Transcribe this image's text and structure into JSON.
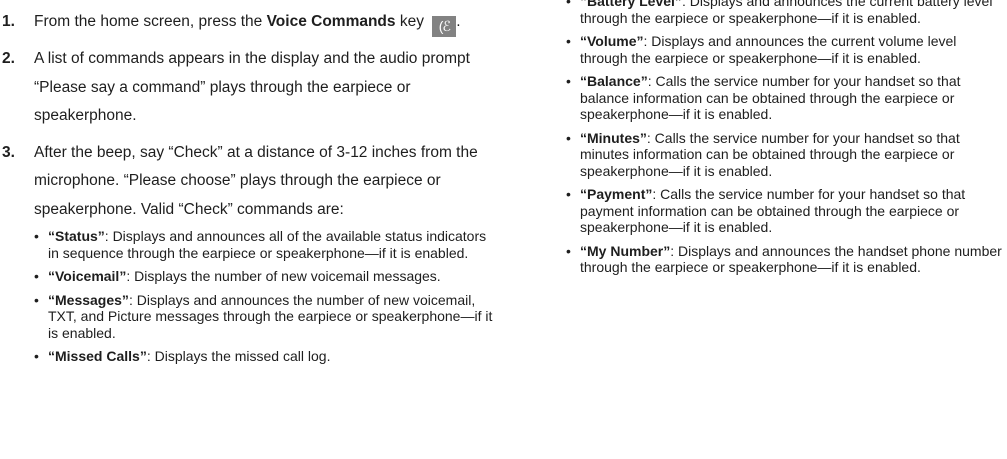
{
  "steps": [
    {
      "num": "1.",
      "text_before": "From the home screen, press the ",
      "bold": "Voice Commands",
      "text_after": " key",
      "key_glyph": "(ℰ"
    },
    {
      "num": "2.",
      "text": "A list of commands appears in the display and the audio prompt “Please say a command” plays through the earpiece or speakerphone."
    },
    {
      "num": "3.",
      "text": "After the beep, say “Check” at a distance of 3-12 inches from the microphone. “Please choose” plays through the earpiece or speakerphone. Valid “Check” commands are:"
    }
  ],
  "commands_left": [
    {
      "name": "“Status”",
      "desc": ": Displays and announces all of the available status indicators in sequence through the earpiece or speakerphone—if it is enabled."
    },
    {
      "name": "“Voicemail”",
      "desc": ": Displays the number of new voicemail messages."
    },
    {
      "name": "“Messages”",
      "desc": ": Displays and announces the number of new voicemail, TXT, and Picture messages through the earpiece or speakerphone—if it is enabled."
    },
    {
      "name": "“Missed Calls”",
      "desc": ": Displays the missed call log."
    }
  ],
  "partial_top": {
    "name": "“Battery Level”",
    "desc": ": Displays and announces the current battery level through the earpiece or speakerphone—if it is enabled."
  },
  "commands_right": [
    {
      "name": "“Volume”",
      "desc": ": Displays and announces the current volume level through the earpiece or speakerphone—if it is enabled."
    },
    {
      "name": "“Balance”",
      "desc": ": Calls the service number for your handset so that balance information can be obtained through the earpiece or speakerphone—if it is enabled."
    },
    {
      "name": "“Minutes”",
      "desc": ": Calls the service number for your handset so that minutes information can be obtained through the earpiece or speakerphone—if it is enabled."
    },
    {
      "name": "“Payment”",
      "desc": ": Calls the service number for your handset so that payment information can be obtained through the earpiece or speakerphone—if it is enabled."
    },
    {
      "name": "“My Number”",
      "desc": ": Displays and announces the handset phone number through the earpiece or speakerphone—if it is enabled."
    }
  ],
  "bullet_glyph": "•",
  "period": "."
}
